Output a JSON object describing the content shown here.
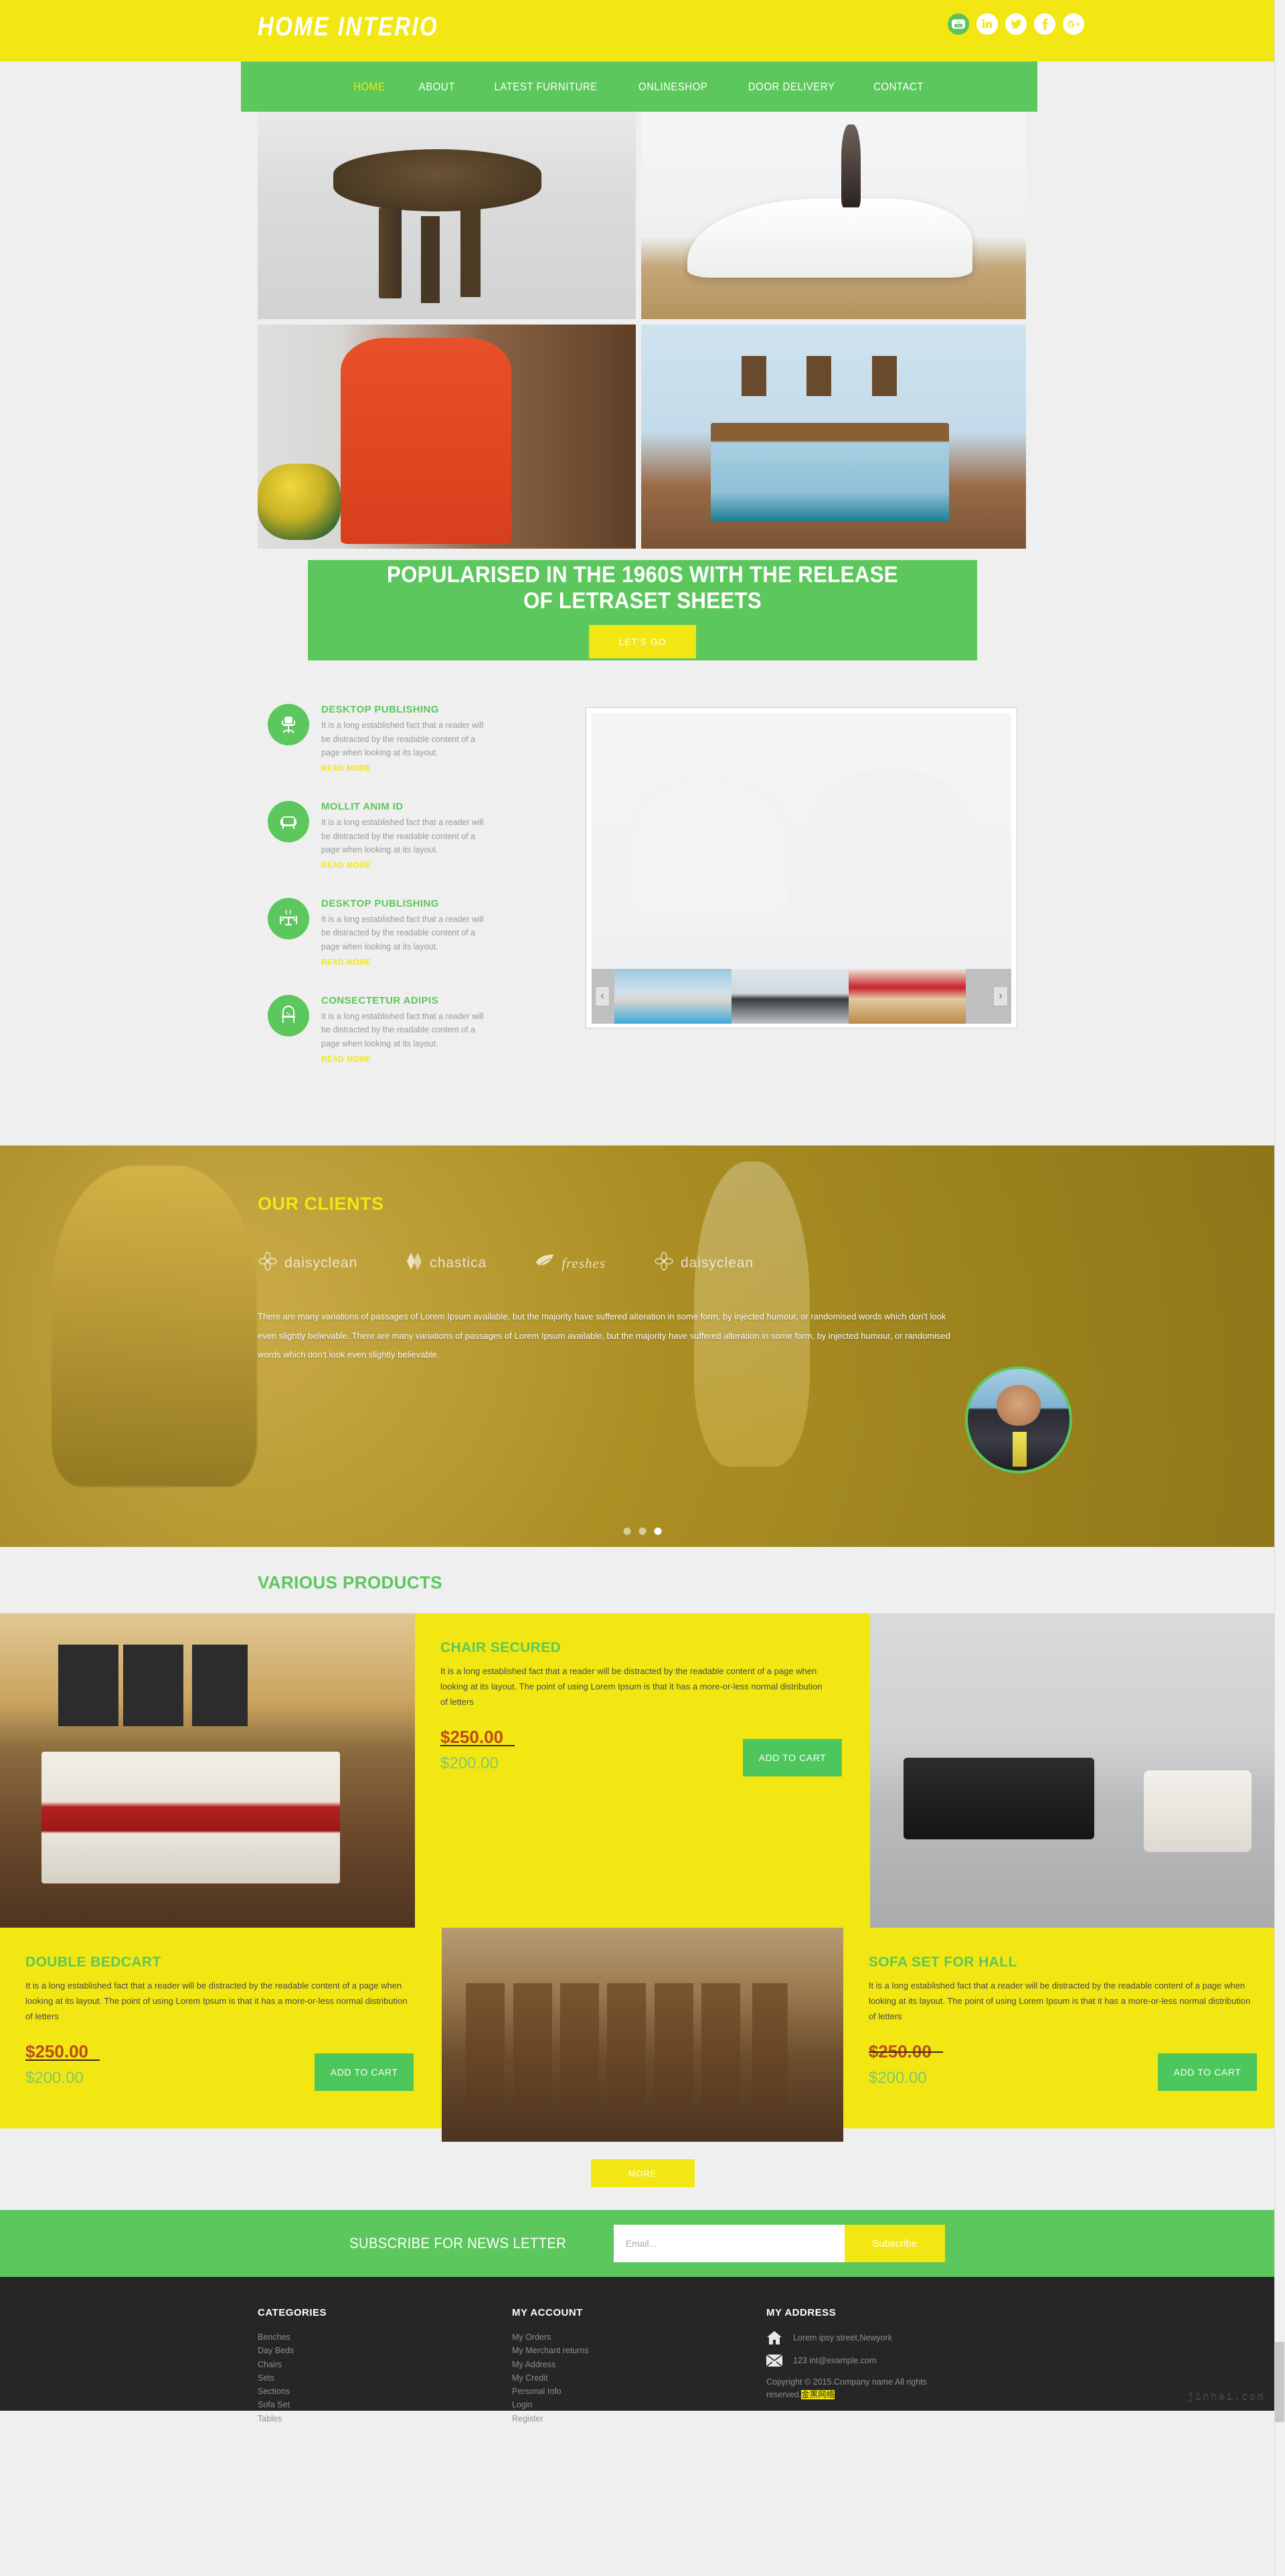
{
  "header": {
    "logo": "HOME  INTERIO",
    "socials": [
      {
        "name": "youtube-icon",
        "label": "YouTube"
      },
      {
        "name": "linkedin-icon",
        "label": "LinkedIn"
      },
      {
        "name": "twitter-icon",
        "label": "Twitter"
      },
      {
        "name": "facebook-icon",
        "label": "Facebook"
      },
      {
        "name": "googleplus-icon",
        "label": "Google Plus"
      }
    ]
  },
  "nav": {
    "items": [
      {
        "label": "HOME",
        "active": true
      },
      {
        "label": "ABOUT",
        "active": false
      },
      {
        "label": "LATEST FURNITURE",
        "active": false
      },
      {
        "label": "ONLINESHOP",
        "active": false
      },
      {
        "label": "DOOR DELIVERY",
        "active": false
      },
      {
        "label": "CONTACT",
        "active": false
      }
    ]
  },
  "hero": {
    "images": [
      {
        "alt": "dining-table-and-chairs"
      },
      {
        "alt": "white-chaise-lounge"
      },
      {
        "alt": "red-wingback-armchair"
      },
      {
        "alt": "bedroom-with-wooden-bed"
      }
    ]
  },
  "promo": {
    "heading": "POPULARISED IN THE 1960S WITH THE RELEASE OF LETRASET SHEETS",
    "button": "LET'S GO"
  },
  "features": {
    "items": [
      {
        "icon": "office-chair-icon",
        "title": "DESKTOP PUBLISHING",
        "text": "It is a long established fact that a reader will be distracted by the readable content of a page when looking at its layout.",
        "link": "READ MORE"
      },
      {
        "icon": "armchair-icon",
        "title": "MOLLIT ANIM ID",
        "text": "It is a long established fact that a reader will be distracted by the readable content of a page when looking at its layout.",
        "link": "READ MORE"
      },
      {
        "icon": "dining-table-icon",
        "title": "DESKTOP PUBLISHING",
        "text": "It is a long established fact that a reader will be distracted by the readable content of a page when looking at its layout.",
        "link": "READ MORE"
      },
      {
        "icon": "bench-icon",
        "title": "CONSECTETUR ADIPIS",
        "text": "It is a long established fact that a reader will be distracted by the readable content of a page when looking at its layout.",
        "link": "READ MORE"
      }
    ]
  },
  "gallery": {
    "main_alt": "two-white-woven-chairs",
    "thumbs": [
      {
        "alt": "beach-umbrella-poolside"
      },
      {
        "alt": "dark-woven-chairs"
      },
      {
        "alt": "modern-kitchen-island"
      }
    ],
    "prev": "‹",
    "next": "›"
  },
  "clients": {
    "title": "OUR CLIENTS",
    "logos": [
      {
        "name": "daisyclean",
        "icon": "flower-icon"
      },
      {
        "name": "chastica",
        "icon": "diamond-icon"
      },
      {
        "name": "freshes",
        "icon": "leaf-icon"
      },
      {
        "name": "daisyclean",
        "icon": "flower-icon"
      }
    ],
    "text": "There are many variations of passages of Lorem Ipsum available, but the majority have suffered alteration in some form, by injected humour, or randomised words which don't look even slightly believable. There are many variations of passages of Lorem Ipsum available, but the majority have suffered alteration in some form, by injected humour, or randomised words which don't look even slightly believable.",
    "avatar_alt": "smiling-man-on-phone",
    "dots": [
      {
        "active": false
      },
      {
        "active": false
      },
      {
        "active": true
      }
    ]
  },
  "products": {
    "title": "VARIOUS PRODUCTS",
    "items": [
      {
        "name": "CHAIR SECURED",
        "description": "It is a long established fact that a reader will be distracted by the readable content of a page when looking at its layout. The point of using Lorem Ipsum is that it has a more-or-less normal distribution of letters",
        "old_price": "$250.00",
        "new_price": "$200.00",
        "cart_label": "ADD TO CART"
      },
      {
        "name": "DOUBLE BEDCART",
        "description": "It is a long established fact that a reader will be distracted by the readable content of a page when looking at its layout. The point of using Lorem Ipsum is that it has a more-or-less normal distribution of letters",
        "old_price": "$250.00",
        "new_price": "$200.00",
        "cart_label": "ADD TO CART"
      },
      {
        "name": "SOFA SET FOR HALL",
        "description": "It is a long established fact that a reader will be distracted by the readable content of a page when looking at its layout. The point of using Lorem Ipsum is that it has a more-or-less normal distribution of letters",
        "old_price": "$250.00",
        "new_price": "$200.00",
        "cart_label": "ADD TO CART"
      }
    ],
    "more_button": "MORE",
    "images": [
      {
        "alt": "bedroom-with-red-blanket"
      },
      {
        "alt": "living-room-black-sofa"
      },
      {
        "alt": "row-of-wooden-chairs"
      }
    ]
  },
  "newsletter": {
    "label": "SUBSCRIBE FOR NEWS LETTER",
    "placeholder": "Email...",
    "value": "",
    "button": "Subscribe"
  },
  "footer": {
    "categories": {
      "title": "CATEGORIES",
      "items": [
        "Benches",
        "Day Beds",
        "Chairs",
        "Sets",
        "Sections",
        "Sofa Set",
        "Tables"
      ]
    },
    "account": {
      "title": "MY ACCOUNT",
      "items": [
        "My Orders",
        "My Merchant returns",
        "My Address",
        "My Credit",
        "Personal Info",
        "Login",
        "Register"
      ]
    },
    "address": {
      "title": "MY ADDRESS",
      "street": "Lorem ipsy street,Newyork",
      "email": "123 int@example.com",
      "copyright_prefix": "Copyright © 2015.Company name All rights reserved.",
      "copyright_badge": "金黑网络"
    },
    "watermark": "jinhei.com"
  },
  "colors": {
    "yellow": "#f2e713",
    "green": "#5cc75c",
    "green_btn": "#4dc65c",
    "page_bg": "#efefef",
    "footer_bg": "#262626",
    "price_old": "#bd4b1a",
    "price_new": "#7dc770",
    "muted": "#9a9a9a"
  }
}
